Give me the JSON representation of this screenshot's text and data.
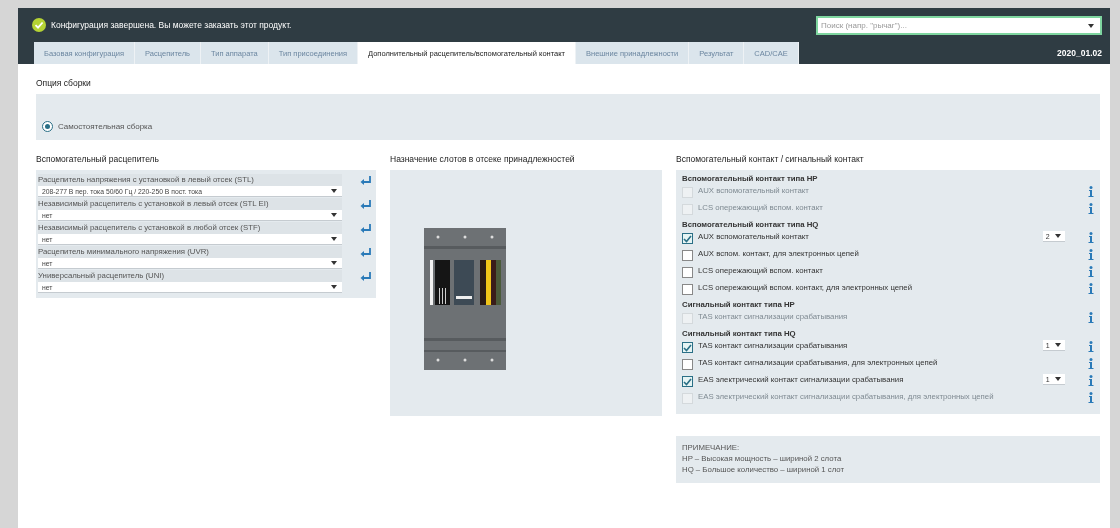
{
  "header": {
    "message": "Конфигурация завершена. Вы можете заказать этот продукт.",
    "search": {
      "placeholder": "Поиск (напр. \"рычаг\")..."
    }
  },
  "tabs": [
    {
      "label": "Базовая конфигурация",
      "selected": false
    },
    {
      "label": "Расцепитель",
      "selected": false
    },
    {
      "label": "Тип аппарата",
      "selected": false
    },
    {
      "label": "Тип присоединения",
      "selected": false
    },
    {
      "label": "Дополнительный расцепитель/вспомогательный контакт",
      "selected": true
    },
    {
      "label": "Внешние принадлежности",
      "selected": false
    },
    {
      "label": "Результат",
      "selected": false
    },
    {
      "label": "CAD/CAE",
      "selected": false
    }
  ],
  "version": "2020_01.02",
  "assembly": {
    "heading": "Опция сборки",
    "options": [
      {
        "label": "Самостоятельная сборка",
        "selected": true
      }
    ]
  },
  "releases": {
    "heading": "Вспомогательный расцепитель",
    "items": [
      {
        "label": "Расцепитель напряжения с установкой в левый отсек (STL)",
        "value": "208-277 В пер. тока 50/60 Гц / 220-250 В пост. тока"
      },
      {
        "label": "Независимый расцепитель с установкой в левый отсек (STL EI)",
        "value": "нет"
      },
      {
        "label": "Независимый расцепитель с установкой в любой отсек (STF)",
        "value": "нет"
      },
      {
        "label": "Расцепитель минимального напряжения (UVR)",
        "value": "нет"
      },
      {
        "label": "Универсальный расцепитель (UNI)",
        "value": "нет"
      }
    ]
  },
  "slots": {
    "heading": "Назначение слотов в отсеке принадлежностей"
  },
  "contacts": {
    "heading": "Вспомогательный контакт / сигнальный контакт",
    "groups": [
      {
        "title": "Вспомогательный контакт типа HP",
        "items": [
          {
            "label": "AUX вспомогательный контакт",
            "checked": false,
            "disabled": true
          },
          {
            "label": "LCS опережающий вспом. контакт",
            "checked": false,
            "disabled": true
          }
        ]
      },
      {
        "title": "Вспомогательный контакт типа HQ",
        "items": [
          {
            "label": "AUX вспомогательный контакт",
            "checked": true,
            "disabled": false,
            "quantity": "2"
          },
          {
            "label": "AUX вспом. контакт, для электронных цепей",
            "checked": false,
            "disabled": false
          },
          {
            "label": "LCS опережающий вспом. контакт",
            "checked": false,
            "disabled": false
          },
          {
            "label": "LCS опережающий вспом. контакт, для электронных цепей",
            "checked": false,
            "disabled": false
          }
        ]
      },
      {
        "title": "Сигнальный контакт типа HP",
        "items": [
          {
            "label": "TAS контакт сигнализации срабатывания",
            "checked": false,
            "disabled": true
          }
        ]
      },
      {
        "title": "Сигнальный контакт типа HQ",
        "items": [
          {
            "label": "TAS контакт сигнализации срабатывания",
            "checked": true,
            "disabled": false,
            "quantity": "1"
          },
          {
            "label": "TAS контакт сигнализации срабатывания, для электронных цепей",
            "checked": false,
            "disabled": false
          },
          {
            "label": "EAS электрический контакт сигнализации срабатывания",
            "checked": true,
            "disabled": false,
            "quantity": "1"
          },
          {
            "label": "EAS электрический контакт сигнализации срабатывания, для электронных цепей",
            "checked": false,
            "disabled": true
          }
        ]
      }
    ]
  },
  "note": {
    "lines": [
      "ПРИМЕЧАНИЕ:",
      "HP – Высокая мощность – шириной 2 слота",
      "HQ – Большое количество – шириной 1 слот"
    ]
  }
}
